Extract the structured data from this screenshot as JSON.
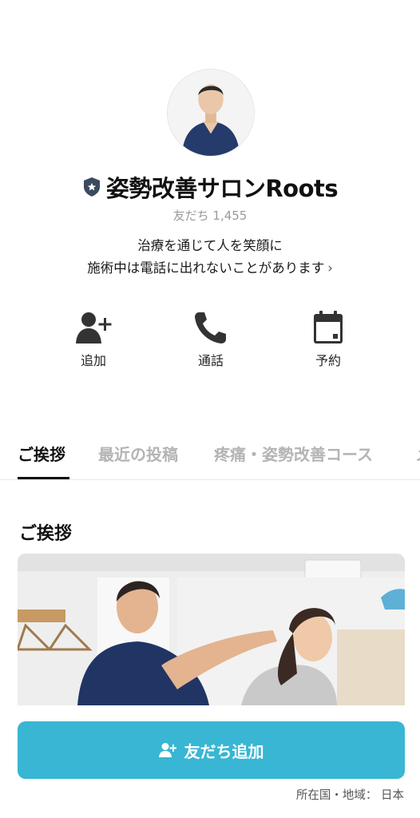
{
  "profile": {
    "name": "姿勢改善サロンRoots",
    "friends_text": "友だち 1,455",
    "status_line1": "治療を通じて人を笑顔に",
    "status_line2": "施術中は電話に出れないことがあります"
  },
  "actions": [
    {
      "label": "追加",
      "icon": "add-friend-icon"
    },
    {
      "label": "通話",
      "icon": "phone-icon"
    },
    {
      "label": "予約",
      "icon": "calendar-icon"
    }
  ],
  "tabs": [
    {
      "label": "ご挨拶",
      "active": true
    },
    {
      "label": "最近の投稿",
      "active": false
    },
    {
      "label": "疼痛・姿勢改善コース",
      "active": false
    },
    {
      "label": "メ",
      "active": false
    }
  ],
  "section": {
    "title": "ご挨拶"
  },
  "cta": {
    "label": "友だち追加",
    "color": "#38b6d3"
  },
  "region": "所在国・地域： 日本"
}
